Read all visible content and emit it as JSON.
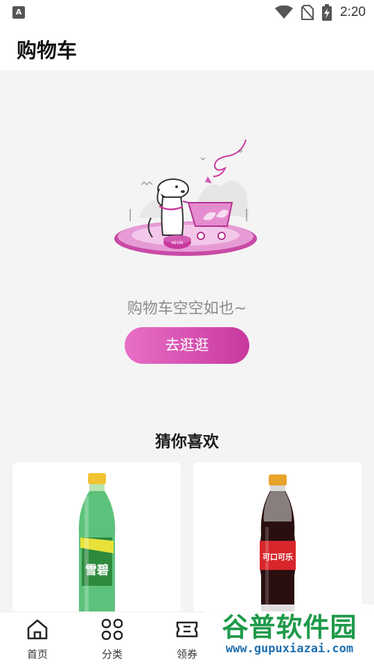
{
  "status_bar": {
    "time": "2:20",
    "app_badge": "A",
    "icons": [
      "wifi-icon",
      "no-sim-icon",
      "battery-charging-icon"
    ]
  },
  "header": {
    "title": "购物车"
  },
  "empty_state": {
    "message": "购物车空空如也~",
    "button_label": "去逛逛",
    "bowl_text": "AEON"
  },
  "recommendations": {
    "title": "猜你喜欢",
    "products": [
      {
        "image": "sprite-bottle",
        "brand_text": "雪碧"
      },
      {
        "image": "coca-cola-bottle",
        "brand_text": "可口可乐"
      }
    ]
  },
  "bottom_nav": {
    "items": [
      {
        "label": "首页",
        "icon": "home-icon"
      },
      {
        "label": "分类",
        "icon": "category-icon"
      },
      {
        "label": "领券",
        "icon": "coupon-icon"
      }
    ]
  },
  "watermark": {
    "title": "谷普软件园",
    "url": "www.gupuxiazai.com"
  },
  "colors": {
    "accent_start": "#e86fc6",
    "accent_end": "#c8389e",
    "background": "#f4f4f4",
    "watermark_green": "#1f9a4a"
  }
}
